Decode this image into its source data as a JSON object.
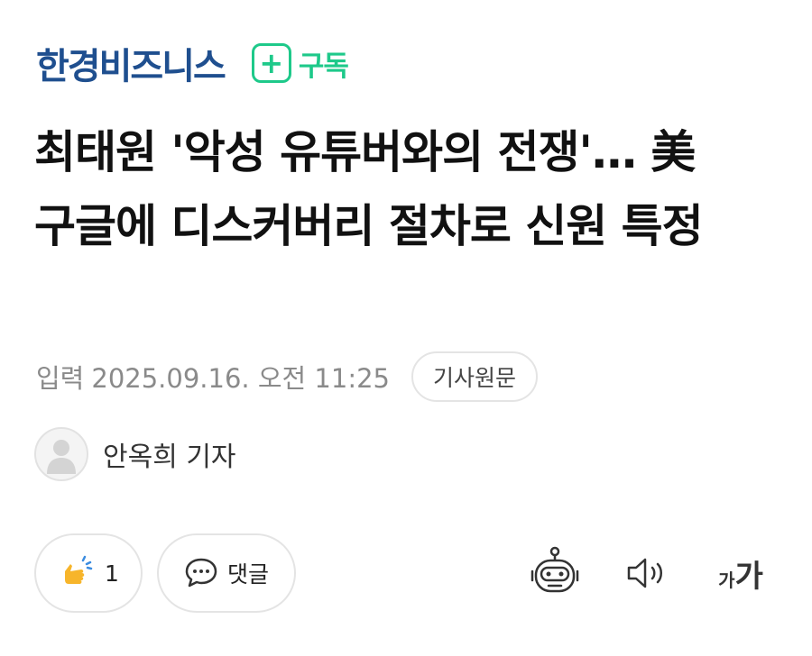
{
  "header": {
    "press_name": "한경비즈니스",
    "subscribe_label": "구독"
  },
  "article": {
    "title": "최태원 '악성 유튜버와의 전쟁'… 美 구글에 디스커버리 절차로 신원 특정",
    "date_label": "입력",
    "date_value": "2025.09.16. 오전 11:25",
    "original_button": "기사원문",
    "reporter": "안옥희 기자"
  },
  "actions": {
    "like_count": "1",
    "comment_label": "댓글",
    "font_small": "가",
    "font_large": "가"
  },
  "icons": {
    "plus": "plus-icon",
    "avatar": "person-icon",
    "like": "clapping-hand-icon",
    "comment": "speech-bubble-icon",
    "summary": "robot-icon",
    "tts": "speaker-icon",
    "font": "font-size-icon"
  },
  "colors": {
    "press_blue": "#1f4f8f",
    "subscribe_green": "#1ec98a",
    "meta_gray": "#8a8a8a",
    "border_gray": "#e4e4e4",
    "hand_yellow": "#f7b52b",
    "sparkle_blue": "#3b8ce0"
  }
}
